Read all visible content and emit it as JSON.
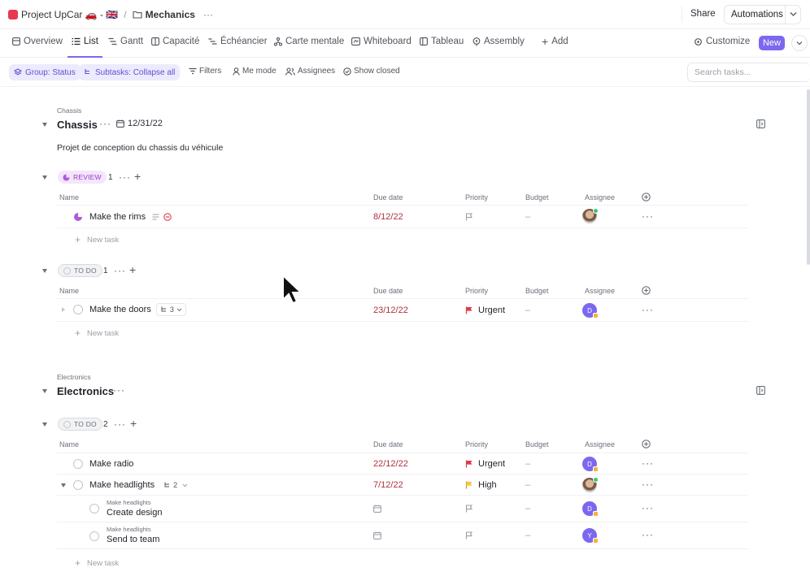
{
  "breadcrumb": {
    "project": "Project UpCar 🚗 - 🇬🇧",
    "separator": "/",
    "folder": "Mechanics",
    "more": "···"
  },
  "topbar": {
    "share": "Share",
    "automations": "Automations"
  },
  "tabs": [
    {
      "label": "Overview",
      "icon": "overview-icon"
    },
    {
      "label": "List",
      "icon": "list-icon",
      "active": true
    },
    {
      "label": "Gantt",
      "icon": "gantt-icon"
    },
    {
      "label": "Capacité",
      "icon": "capacity-icon"
    },
    {
      "label": "Échéancier",
      "icon": "timeline-icon"
    },
    {
      "label": "Carte mentale",
      "icon": "mindmap-icon"
    },
    {
      "label": "Whiteboard",
      "icon": "whiteboard-icon"
    },
    {
      "label": "Tableau",
      "icon": "board-icon"
    },
    {
      "label": "Assembly",
      "icon": "assembly-icon"
    },
    {
      "label": "Add",
      "icon": "plus-icon"
    }
  ],
  "tabs_right": {
    "customize": "Customize",
    "new": "New"
  },
  "filters": {
    "group": "Group: Status",
    "subtasks": "Subtasks: Collapse all",
    "filters": "Filters",
    "me_mode": "Me mode",
    "assignees": "Assignees",
    "show_closed": "Show closed",
    "search_placeholder": "Search tasks..."
  },
  "columns": {
    "name": "Name",
    "due": "Due date",
    "priority": "Priority",
    "budget": "Budget",
    "assignee": "Assignee"
  },
  "new_task": "New task",
  "lists": {
    "chassis": {
      "location": "Chassis",
      "title": "Chassis",
      "date": "12/31/22",
      "description": "Projet de conception du chassis du véhicule",
      "review": {
        "status": "REVIEW",
        "count": "1",
        "tasks": [
          {
            "name": "Make the rims",
            "due": "8/12/22",
            "priority": "",
            "budget": "–"
          }
        ]
      },
      "todo": {
        "status": "TO DO",
        "count": "1",
        "tasks": [
          {
            "name": "Make the doors",
            "subtasks": "3",
            "due": "23/12/22",
            "priority": "Urgent",
            "budget": "–"
          }
        ]
      }
    },
    "electronics": {
      "location": "Electronics",
      "title": "Electronics",
      "todo": {
        "status": "TO DO",
        "count": "2",
        "tasks": [
          {
            "name": "Make radio",
            "due": "22/12/22",
            "priority": "Urgent",
            "budget": "–"
          },
          {
            "name": "Make headlights",
            "subtasks": "2",
            "due": "7/12/22",
            "priority": "High",
            "budget": "–"
          },
          {
            "parent": "Make headlights",
            "name": "Create design",
            "budget": "–"
          },
          {
            "parent": "Make headlights",
            "name": "Send to team",
            "budget": "–"
          }
        ]
      }
    }
  },
  "colors": {
    "accent": "#7b68ee",
    "urgent": "#e03a4a",
    "high": "#f4c53d",
    "due": "#b0313f",
    "review": "#9b38c8"
  }
}
